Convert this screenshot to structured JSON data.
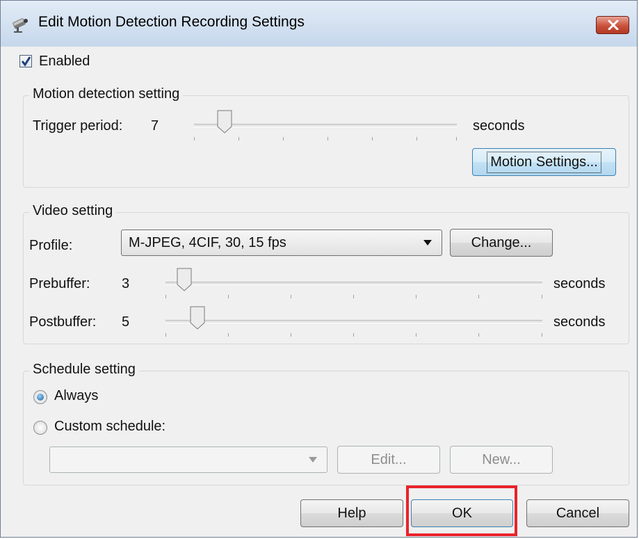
{
  "window": {
    "title": "Edit Motion Detection Recording Settings"
  },
  "enabled": {
    "label": "Enabled",
    "checked": true
  },
  "motion_group": {
    "legend": "Motion detection setting",
    "trigger_label": "Trigger period:",
    "trigger_value": "7",
    "trigger_unit": "seconds",
    "motion_settings_button": "Motion Settings..."
  },
  "video_group": {
    "legend": "Video setting",
    "profile_label": "Profile:",
    "profile_value": "M-JPEG, 4CIF, 30, 15 fps",
    "change_button": "Change...",
    "prebuffer_label": "Prebuffer:",
    "prebuffer_value": "3",
    "prebuffer_unit": "seconds",
    "postbuffer_label": "Postbuffer:",
    "postbuffer_value": "5",
    "postbuffer_unit": "seconds"
  },
  "schedule_group": {
    "legend": "Schedule setting",
    "always_label": "Always",
    "custom_label": "Custom schedule:",
    "schedule_value": "",
    "edit_button": "Edit...",
    "new_button": "New..."
  },
  "footer": {
    "help_button": "Help",
    "ok_button": "OK",
    "cancel_button": "Cancel"
  },
  "colors": {
    "highlight": "#e8232a",
    "title_bar": "#c5d7ec",
    "close_button": "#c9513c"
  },
  "icons": {
    "app": "camera-icon",
    "close": "close-icon"
  }
}
